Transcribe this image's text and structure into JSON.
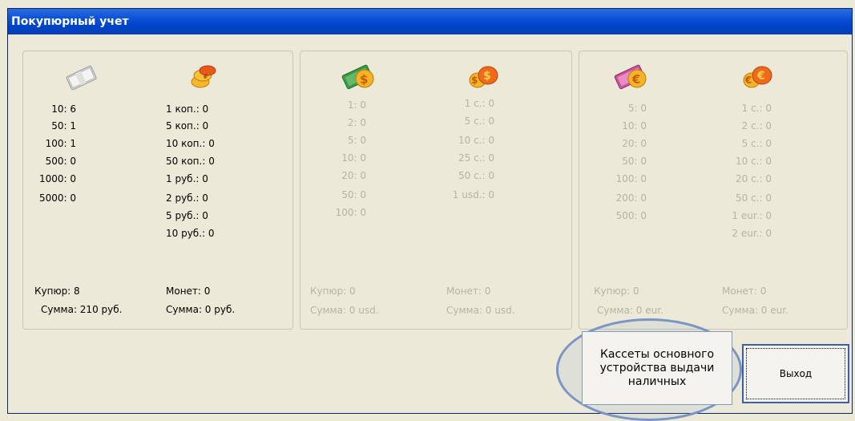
{
  "window": {
    "title": "Покупюрный учет"
  },
  "panels": [
    {
      "name": "rub",
      "notes": [
        {
          "label": "10: 6"
        },
        {
          "label": "50: 1"
        },
        {
          "label": "100: 1"
        },
        {
          "label": "500: 0"
        },
        {
          "label": "1000: 0"
        },
        {
          "label": "5000: 0"
        }
      ],
      "coins": [
        {
          "label": "1 коп.: 0"
        },
        {
          "label": "5 коп.: 0"
        },
        {
          "label": "10 коп.: 0"
        },
        {
          "label": "50 коп.: 0"
        },
        {
          "label": "1 руб.: 0"
        },
        {
          "label": "2 руб.: 0"
        },
        {
          "label": "5 руб.: 0"
        },
        {
          "label": "10 руб.: 0"
        }
      ],
      "notes_count": "Купюр: 8",
      "notes_sum": "Сумма: 210 руб.",
      "coins_count": "Монет: 0",
      "coins_sum": "Сумма: 0 руб."
    },
    {
      "name": "usd",
      "notes": [
        {
          "label": "1: 0"
        },
        {
          "label": "2: 0"
        },
        {
          "label": "5: 0"
        },
        {
          "label": "10: 0"
        },
        {
          "label": "20: 0"
        },
        {
          "label": "50: 0"
        },
        {
          "label": "100: 0"
        }
      ],
      "coins": [
        {
          "label": "1 c.: 0"
        },
        {
          "label": "5 c.: 0"
        },
        {
          "label": "10 c.: 0"
        },
        {
          "label": "25 c.: 0"
        },
        {
          "label": "50 c.: 0"
        },
        {
          "label": "1 usd.: 0"
        }
      ],
      "notes_count": "Купюр: 0",
      "notes_sum": "Сумма: 0 usd.",
      "coins_count": "Монет: 0",
      "coins_sum": "Сумма: 0 usd."
    },
    {
      "name": "eur",
      "notes": [
        {
          "label": "5: 0"
        },
        {
          "label": "10: 0"
        },
        {
          "label": "20: 0"
        },
        {
          "label": "50: 0"
        },
        {
          "label": "100: 0"
        },
        {
          "label": "200: 0"
        },
        {
          "label": "500: 0"
        }
      ],
      "coins": [
        {
          "label": "1 c.: 0"
        },
        {
          "label": "2 c.: 0"
        },
        {
          "label": "5 c.: 0"
        },
        {
          "label": "10 c.: 0"
        },
        {
          "label": "20 c.: 0"
        },
        {
          "label": "50 c.: 0"
        },
        {
          "label": "1 eur.: 0"
        },
        {
          "label": "2 eur.: 0"
        }
      ],
      "notes_count": "Купюр: 0",
      "notes_sum": "Сумма: 0 eur.",
      "coins_count": "Монет: 0",
      "coins_sum": "Сумма: 0 eur."
    }
  ],
  "buttons": {
    "cassettes": "Кассеты основного устройства выдачи наличных",
    "exit": "Выход"
  }
}
